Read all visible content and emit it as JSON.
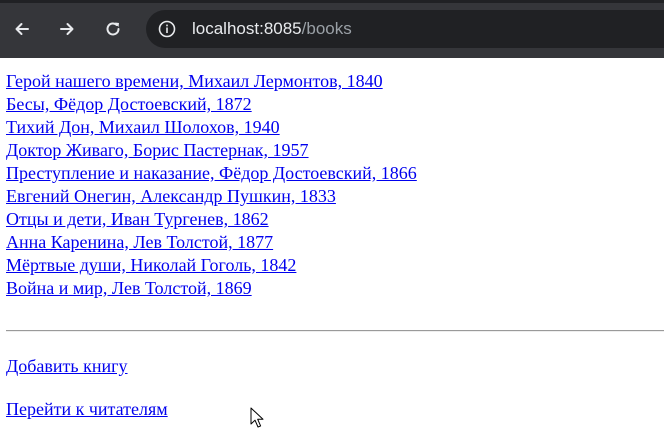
{
  "browser": {
    "url_host": "localhost:8085",
    "url_path": "/books"
  },
  "books": [
    "Герой нашего времени, Михаил Лермонтов, 1840",
    "Бесы, Фёдор Достоевский, 1872",
    "Тихий Дон, Михаил Шолохов, 1940",
    "Доктор Живаго, Борис Пастернак, 1957",
    "Преступление и наказание, Фёдор Достоевский, 1866",
    "Евгений Онегин, Александр Пушкин, 1833",
    "Отцы и дети, Иван Тургенев, 1862",
    "Анна Каренина, Лев Толстой, 1877",
    "Мёртвые души, Николай Гоголь, 1842",
    "Война и мир, Лев Толстой, 1869"
  ],
  "links": {
    "add_book": "Добавить книгу",
    "go_to_readers": "Перейти к читателям"
  }
}
